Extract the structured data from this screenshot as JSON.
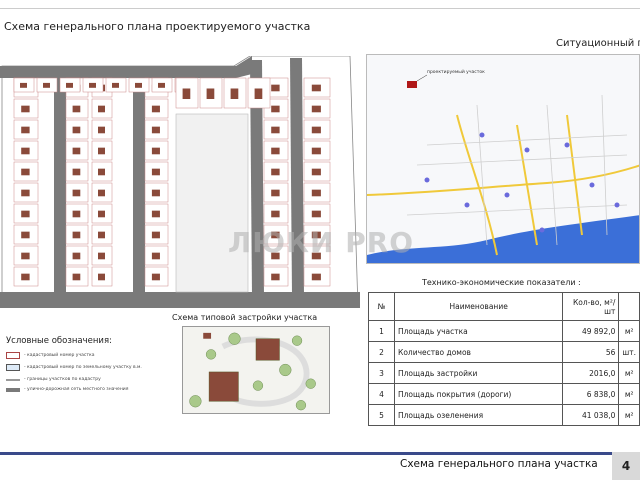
{
  "page": {
    "title": "Схема генерального плана проектируемого участка",
    "situation_title": "Ситуационный пла",
    "typical_title": "Схема типовой застройки участка",
    "footer_title": "Схема генерального плана участка",
    "page_number": "4",
    "watermark": "ЛЮКИ PRO"
  },
  "situation_map": {
    "marker_label": "проектируемый участок",
    "colors": {
      "roads": "#f0c93a",
      "water": "#3b6fd8",
      "marker": "#b01818",
      "poi": "#6a6adc"
    }
  },
  "legend": {
    "title": "Условные обозначения:",
    "items": [
      {
        "label": "- кадастровый номер участка",
        "icon": "lot-number-swatch"
      },
      {
        "label": "- кадастровый номер по земельному участку в.м.",
        "icon": "lot-house-swatch"
      },
      {
        "label": "- границы участков по кадастру",
        "icon": "boundary-line"
      },
      {
        "label": "- улично-дорожная сеть местного значения",
        "icon": "road-line"
      }
    ]
  },
  "tep": {
    "title": "Технико-экономические показатели :",
    "headers": [
      "№",
      "Наименование",
      "Кол-во, м²/шт",
      ""
    ],
    "rows": [
      {
        "n": "1",
        "name": "Площадь участка",
        "value": "49 892,0",
        "unit": "м²"
      },
      {
        "n": "2",
        "name": "Количество домов",
        "value": "56",
        "unit": "шт."
      },
      {
        "n": "3",
        "name": "Площадь застройки",
        "value": "2016,0",
        "unit": "м²"
      },
      {
        "n": "4",
        "name": "Площадь покрытия (дороги)",
        "value": "6 838,0",
        "unit": "м²"
      },
      {
        "n": "5",
        "name": "Площадь озеленения",
        "value": "41 038,0",
        "unit": "м²"
      }
    ]
  }
}
